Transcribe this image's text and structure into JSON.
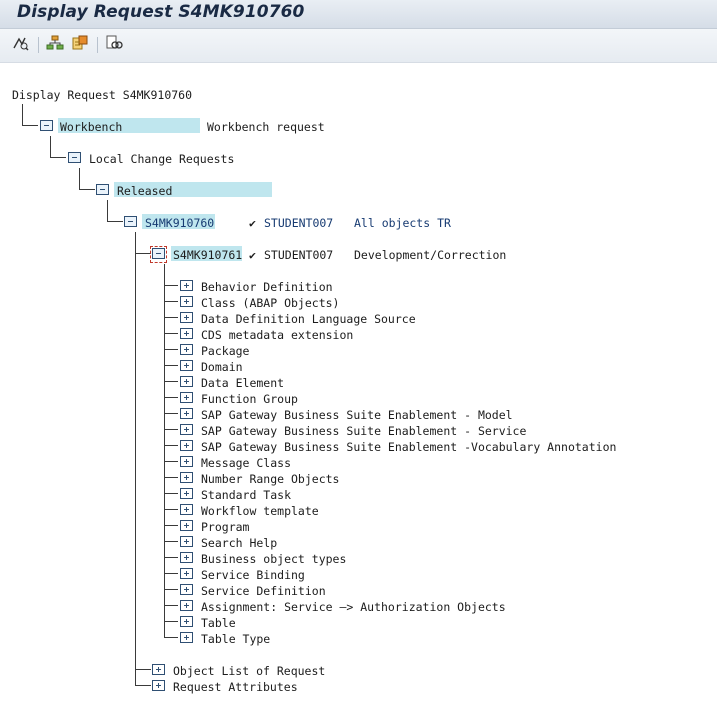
{
  "window": {
    "title": "Display Request S4MK910760"
  },
  "toolbar": {
    "buttons": [
      {
        "icon": "display-change-icon"
      },
      {
        "icon": "hierarchy-icon"
      },
      {
        "icon": "transport-icon"
      },
      {
        "icon": "find-icon"
      }
    ]
  },
  "tree": {
    "root": "Display Request S4MK910760",
    "workbench": {
      "label": "Workbench",
      "desc": "Workbench request"
    },
    "local": {
      "label": "Local Change Requests"
    },
    "released": {
      "label": "Released"
    },
    "request": {
      "id": "S4MK910760",
      "check": "✔",
      "owner": "STUDENT007",
      "desc": "All objects TR"
    },
    "task": {
      "id": "S4MK910761",
      "check": "✔",
      "owner": "STUDENT007",
      "desc": "Development/Correction"
    },
    "object_types": [
      "Behavior Definition",
      "Class (ABAP Objects)",
      "Data Definition Language Source",
      "CDS metadata extension",
      "Package",
      "Domain",
      "Data Element",
      "Function Group",
      "SAP Gateway Business Suite Enablement - Model",
      "SAP Gateway Business Suite Enablement - Service",
      "SAP Gateway Business Suite Enablement -Vocabulary Annotation",
      "Message Class",
      "Number Range Objects",
      "Standard Task",
      "Workflow template",
      "Program",
      "Search Help",
      "Business object types",
      "Service Binding",
      "Service Definition",
      "Assignment: Service —> Authorization Objects",
      "Table",
      "Table Type"
    ],
    "object_list": "Object List of Request",
    "request_attributes": "Request Attributes"
  }
}
